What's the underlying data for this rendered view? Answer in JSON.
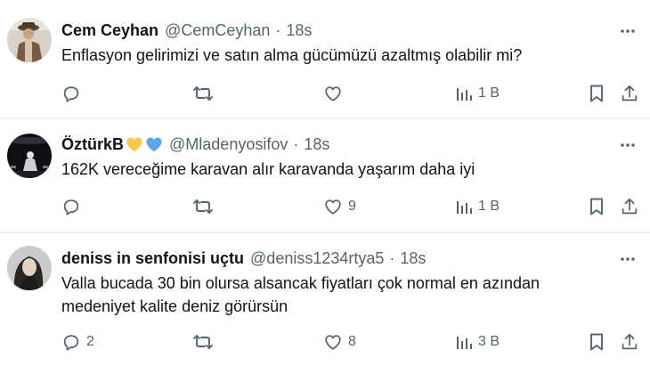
{
  "colors": {
    "text": "#0f1419",
    "secondary": "#536471",
    "divider": "#e6e9ec",
    "heart_yellow": "#f7c948",
    "heart_blue": "#5aa9e6"
  },
  "tweets": [
    {
      "name": "Cem Ceyhan",
      "handle": "@CemCeyhan",
      "separator": "·",
      "time": "18s",
      "text_lines": [
        "Enflasyon gelirimizi ve satın alma gücümüzü azaltmış olabilir mi?"
      ],
      "replies": "",
      "retweets": "",
      "likes": "",
      "views": "1 B",
      "icons": [
        "reply-icon",
        "retweet-icon",
        "like-icon",
        "views-icon",
        "bookmark-icon",
        "share-icon",
        "more-icon"
      ]
    },
    {
      "name": "ÖztürkB",
      "name_emojis": [
        "yellow-heart",
        "blue-heart"
      ],
      "handle": "@Mladenyosifov",
      "separator": "·",
      "time": "18s",
      "text_lines": [
        "162K vereceğime karavan alır karavanda yaşarım daha iyi"
      ],
      "replies": "",
      "retweets": "",
      "likes": "9",
      "views": "1 B",
      "icons": [
        "reply-icon",
        "retweet-icon",
        "like-icon",
        "views-icon",
        "bookmark-icon",
        "share-icon",
        "more-icon"
      ]
    },
    {
      "name": "deniss in senfonisi uçtu",
      "handle": "@deniss1234rtya5",
      "separator": "·",
      "time": "18s",
      "text_lines": [
        "Valla bucada 30 bin olursa alsancak fiyatları çok normal en azından",
        "medeniyet kalite deniz görürsün"
      ],
      "replies": "2",
      "retweets": "",
      "likes": "8",
      "views": "3 B",
      "icons": [
        "reply-icon",
        "retweet-icon",
        "like-icon",
        "views-icon",
        "bookmark-icon",
        "share-icon",
        "more-icon"
      ]
    }
  ]
}
